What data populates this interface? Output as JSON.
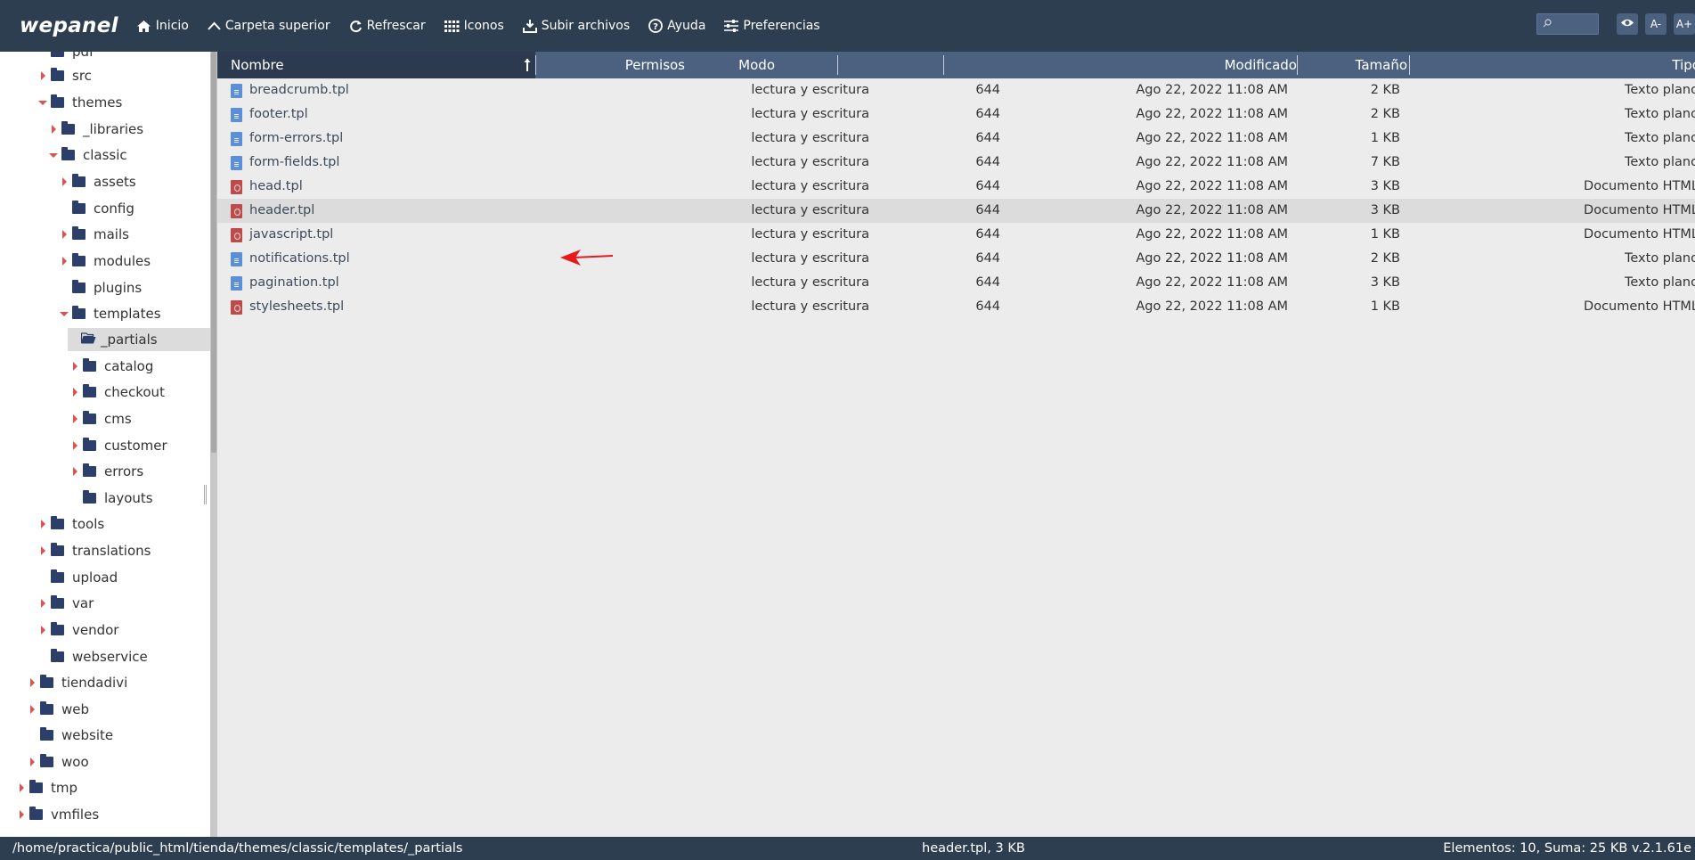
{
  "app": {
    "logo": "wepanel"
  },
  "toolbar": {
    "items": [
      {
        "label": "Inicio",
        "icon": "home-icon"
      },
      {
        "label": "Carpeta superior",
        "icon": "chevron-up-icon"
      },
      {
        "label": "Refrescar",
        "icon": "refresh-icon"
      },
      {
        "label": "Iconos",
        "icon": "grid-icon"
      },
      {
        "label": "Subir archivos",
        "icon": "upload-icon"
      },
      {
        "label": "Ayuda",
        "icon": "help-icon"
      },
      {
        "label": "Preferencias",
        "icon": "sliders-icon"
      }
    ],
    "search_placeholder": "",
    "font_decrease": "A-",
    "font_increase": "A+",
    "colors": {
      "bar": "#2c3e50",
      "button": "#4c6180"
    }
  },
  "tree": {
    "items": [
      {
        "label": "pdf",
        "caret": "none"
      },
      {
        "label": "src",
        "caret": "right"
      },
      {
        "label": "themes",
        "caret": "down"
      },
      {
        "label": "_libraries",
        "caret": "right"
      },
      {
        "label": "classic",
        "caret": "down"
      },
      {
        "label": "assets",
        "caret": "right"
      },
      {
        "label": "config",
        "caret": "none"
      },
      {
        "label": "mails",
        "caret": "right"
      },
      {
        "label": "modules",
        "caret": "right"
      },
      {
        "label": "plugins",
        "caret": "none"
      },
      {
        "label": "templates",
        "caret": "down"
      },
      {
        "label": "_partials",
        "caret": "none",
        "selected": true,
        "open": true
      },
      {
        "label": "catalog",
        "caret": "right"
      },
      {
        "label": "checkout",
        "caret": "right"
      },
      {
        "label": "cms",
        "caret": "right"
      },
      {
        "label": "customer",
        "caret": "right"
      },
      {
        "label": "errors",
        "caret": "right"
      },
      {
        "label": "layouts",
        "caret": "none"
      },
      {
        "label": "tools",
        "caret": "right"
      },
      {
        "label": "translations",
        "caret": "right"
      },
      {
        "label": "upload",
        "caret": "none"
      },
      {
        "label": "var",
        "caret": "right"
      },
      {
        "label": "vendor",
        "caret": "right"
      },
      {
        "label": "webservice",
        "caret": "none"
      },
      {
        "label": "tiendadivi",
        "caret": "right"
      },
      {
        "label": "web",
        "caret": "right"
      },
      {
        "label": "website",
        "caret": "none"
      },
      {
        "label": "woo",
        "caret": "right"
      },
      {
        "label": "tmp",
        "caret": "right"
      },
      {
        "label": "vmfiles",
        "caret": "right"
      }
    ]
  },
  "table": {
    "columns": {
      "name": "Nombre",
      "perms": "Permisos",
      "mode": "Modo",
      "modified": "Modificado",
      "size": "Tamaño",
      "type": "Tipo"
    },
    "rows": [
      {
        "name": "breadcrumb.tpl",
        "perms": "lectura y escritura",
        "mode": "644",
        "modified": "Ago 22, 2022 11:08 AM",
        "size": "2 KB",
        "type": "Texto plano",
        "kind": "text"
      },
      {
        "name": "footer.tpl",
        "perms": "lectura y escritura",
        "mode": "644",
        "modified": "Ago 22, 2022 11:08 AM",
        "size": "2 KB",
        "type": "Texto plano",
        "kind": "text"
      },
      {
        "name": "form-errors.tpl",
        "perms": "lectura y escritura",
        "mode": "644",
        "modified": "Ago 22, 2022 11:08 AM",
        "size": "1 KB",
        "type": "Texto plano",
        "kind": "text"
      },
      {
        "name": "form-fields.tpl",
        "perms": "lectura y escritura",
        "mode": "644",
        "modified": "Ago 22, 2022 11:08 AM",
        "size": "7 KB",
        "type": "Texto plano",
        "kind": "text"
      },
      {
        "name": "head.tpl",
        "perms": "lectura y escritura",
        "mode": "644",
        "modified": "Ago 22, 2022 11:08 AM",
        "size": "3 KB",
        "type": "Documento HTML",
        "kind": "html"
      },
      {
        "name": "header.tpl",
        "perms": "lectura y escritura",
        "mode": "644",
        "modified": "Ago 22, 2022 11:08 AM",
        "size": "3 KB",
        "type": "Documento HTML",
        "kind": "html",
        "highlighted": true
      },
      {
        "name": "javascript.tpl",
        "perms": "lectura y escritura",
        "mode": "644",
        "modified": "Ago 22, 2022 11:08 AM",
        "size": "1 KB",
        "type": "Documento HTML",
        "kind": "html"
      },
      {
        "name": "notifications.tpl",
        "perms": "lectura y escritura",
        "mode": "644",
        "modified": "Ago 22, 2022 11:08 AM",
        "size": "2 KB",
        "type": "Texto plano",
        "kind": "text"
      },
      {
        "name": "pagination.tpl",
        "perms": "lectura y escritura",
        "mode": "644",
        "modified": "Ago 22, 2022 11:08 AM",
        "size": "3 KB",
        "type": "Texto plano",
        "kind": "text"
      },
      {
        "name": "stylesheets.tpl",
        "perms": "lectura y escritura",
        "mode": "644",
        "modified": "Ago 22, 2022 11:08 AM",
        "size": "1 KB",
        "type": "Documento HTML",
        "kind": "html"
      }
    ]
  },
  "status": {
    "path": "/home/practica/public_html/tienda/themes/classic/templates/_partials",
    "selection": "header.tpl, 3 KB",
    "info": "Elementos: 10, Suma: 25 KB v.2.1.61e"
  }
}
